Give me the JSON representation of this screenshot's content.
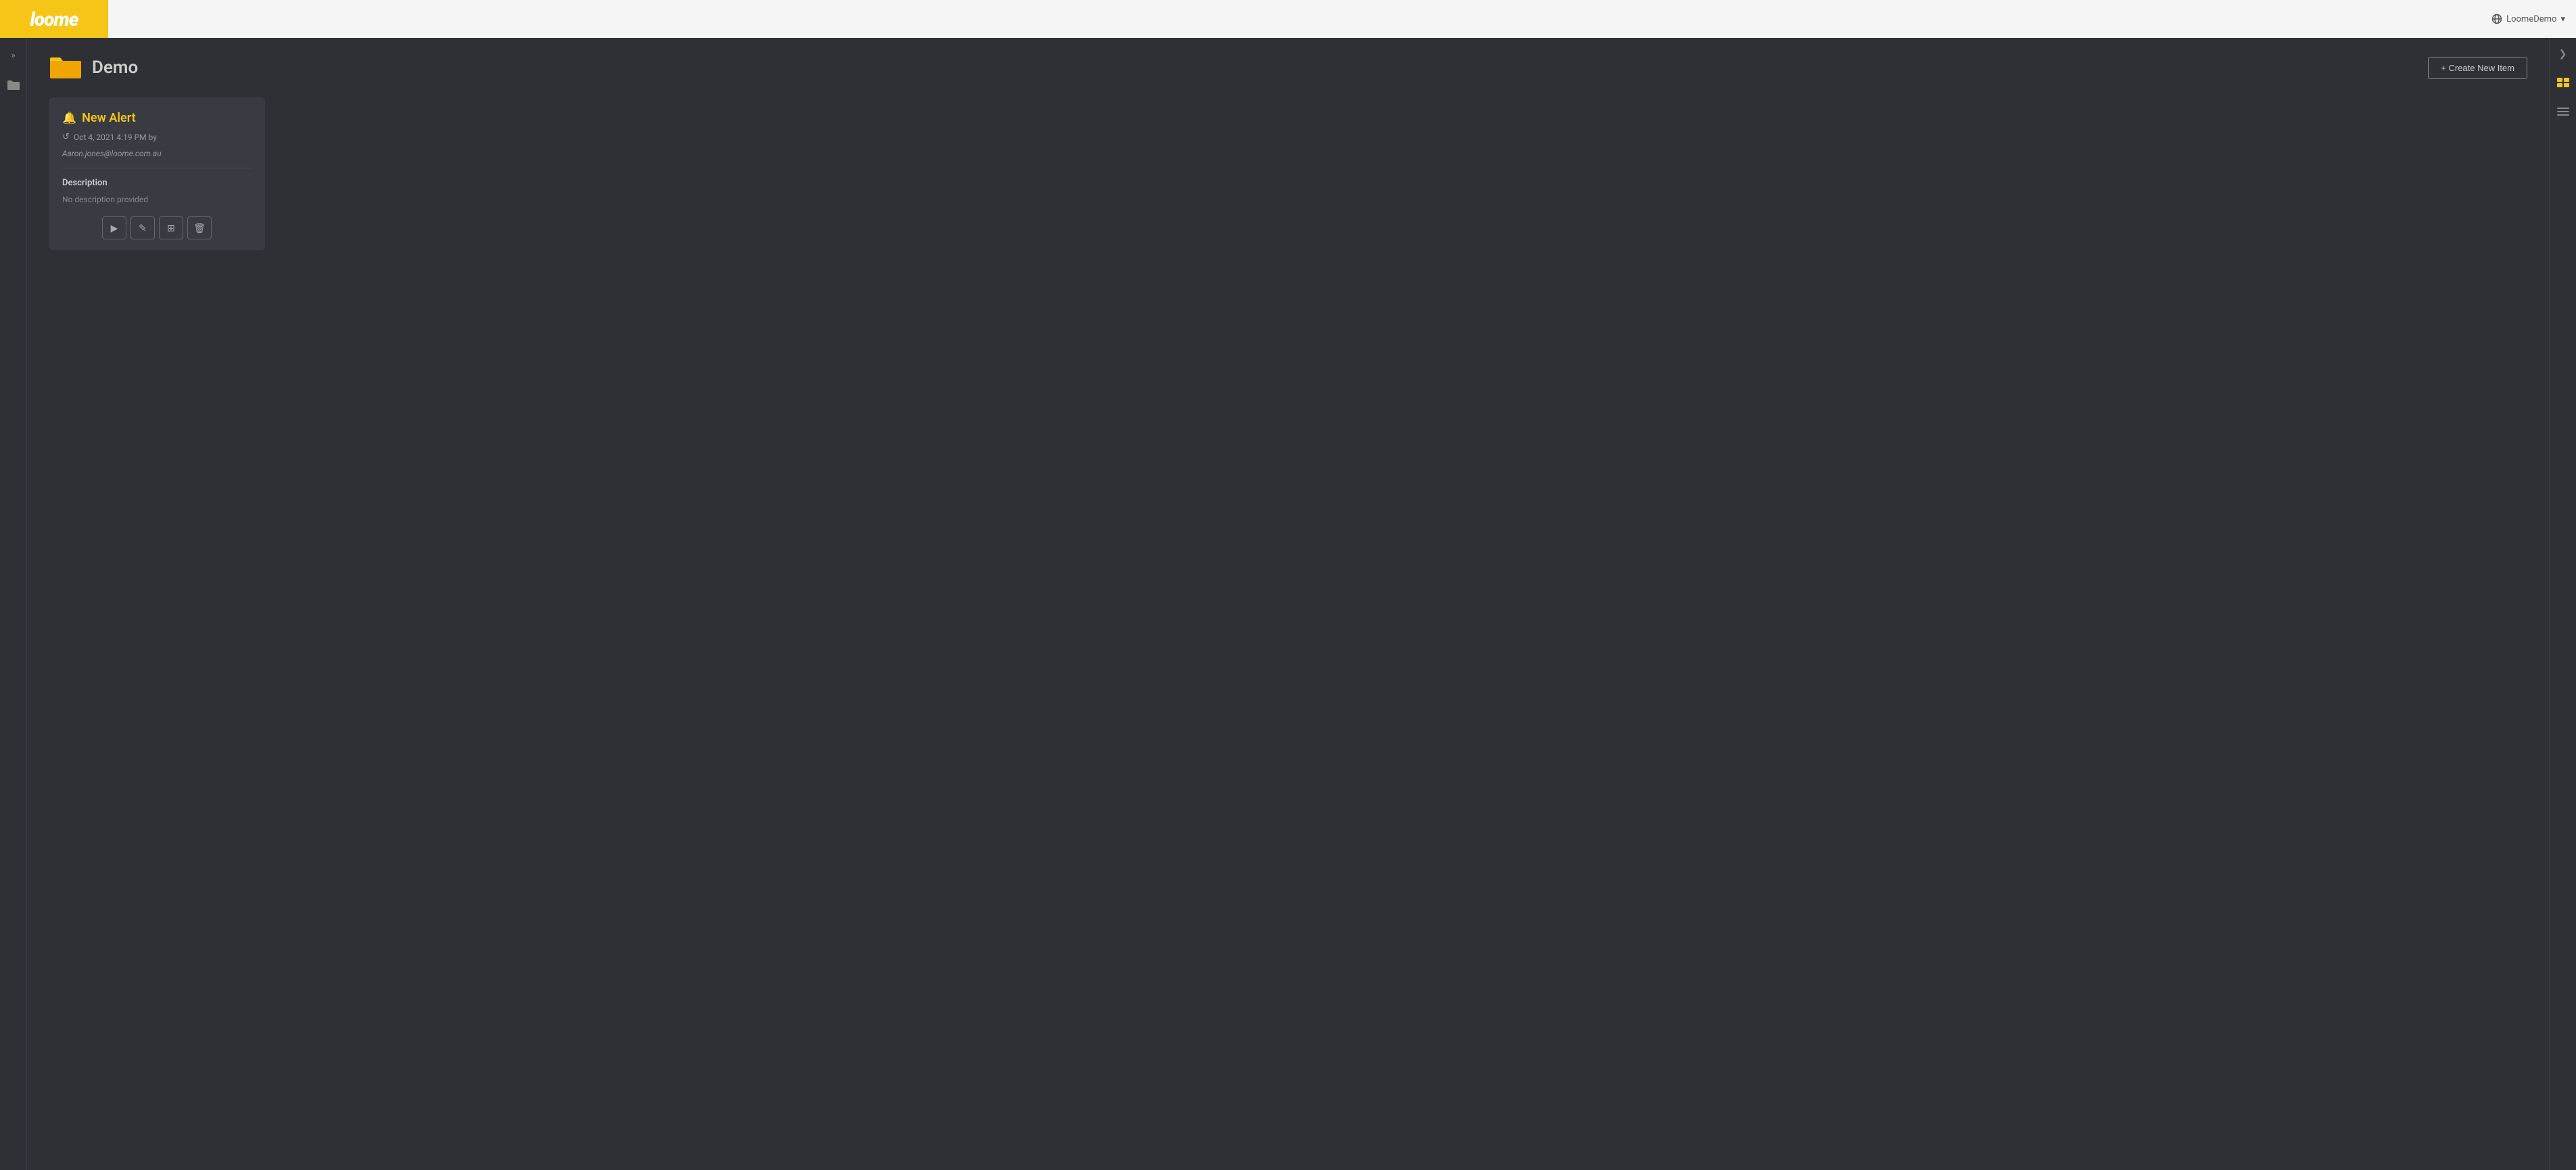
{
  "app": {
    "logo": "loome",
    "user": {
      "label": "LoomeDemo",
      "dropdown_arrow": "▾"
    }
  },
  "sidebar": {
    "top_icon": "»",
    "folder_icon": "📁"
  },
  "page": {
    "title": "Demo",
    "create_button": "+ Create New Item"
  },
  "card": {
    "title": "New Alert",
    "meta_date": "Oct 4, 2021 4:19 PM by",
    "meta_email": "Aaron.jones@loome.com.au",
    "description_label": "Description",
    "description_value": "No description provided",
    "actions": {
      "play": "▶",
      "edit": "✎",
      "table": "⊞",
      "delete": "🗑"
    }
  },
  "right_sidebar": {
    "collapse": "❯",
    "card_view_icon": "▬",
    "list_view_icon": "☰"
  },
  "colors": {
    "accent": "#f5c518",
    "bg_main": "#2e3035",
    "bg_card": "#383b41",
    "text_primary": "#cccccc",
    "text_muted": "#888888"
  }
}
